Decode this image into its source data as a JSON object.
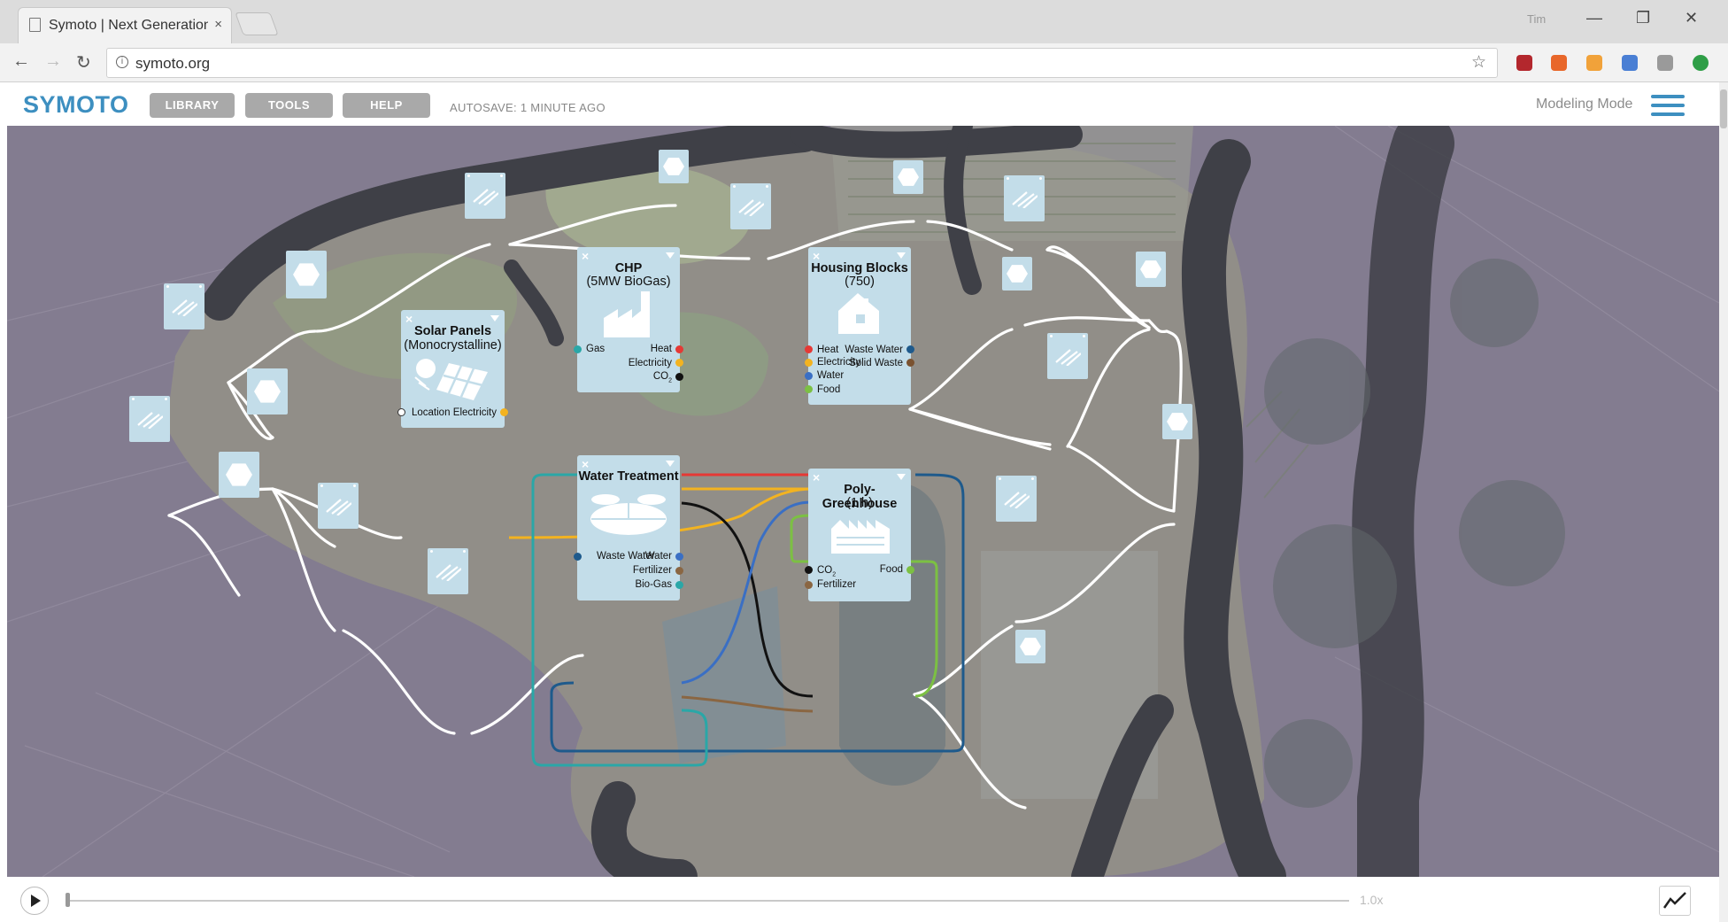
{
  "browser": {
    "tab_title": "Symoto | Next Generation",
    "user_label": "Tim",
    "url": "symoto.org"
  },
  "app": {
    "logo": "SYMOTO",
    "buttons": [
      "LIBRARY",
      "TOOLS",
      "HELP"
    ],
    "autosave": "AUTOSAVE: 1 MINUTE AGO",
    "mode": "Modeling Mode",
    "accent_color": "#3d8fc0"
  },
  "modules": {
    "solar": {
      "title": "Solar Panels",
      "subtitle": "(Monocrystalline)",
      "inputs": [
        "Location"
      ],
      "outputs": [
        "Electricity"
      ]
    },
    "chp": {
      "title": "CHP",
      "subtitle": "(5MW BioGas)",
      "inputs": [
        "Gas"
      ],
      "outputs": [
        "Heat",
        "Electricity",
        "CO",
        "2"
      ]
    },
    "housing": {
      "title": "Housing Blocks",
      "subtitle": "(750)",
      "inputs": [
        "Heat",
        "Electricity",
        "Water",
        "Food"
      ],
      "outputs": [
        "Waste Water",
        "Solid Waste"
      ]
    },
    "water": {
      "title": "Water Treatment",
      "inputs": [
        "Waste Water"
      ],
      "outputs": [
        "Water",
        "Fertilizer",
        "Bio-Gas"
      ]
    },
    "greenhouse": {
      "title": "Poly-Greenhouse",
      "subtitle": "(1 h)",
      "inputs": [
        "CO",
        "2",
        "Fertilizer"
      ],
      "outputs": [
        "Food"
      ]
    }
  },
  "flow_colors": {
    "heat": "#e53935",
    "electricity": "#f3b320",
    "co2": "#111111",
    "water": "#3a6fc4",
    "food": "#7cc043",
    "waste_water": "#1e5a8c",
    "solid_waste": "#7a5230",
    "fertilizer": "#8a6642",
    "biogas": "#2aa7a7"
  },
  "playback": {
    "speed": "1.0x"
  },
  "icons": [
    "play-icon",
    "graph-icon",
    "hamburger-menu-icon",
    "factory-icon",
    "house-icon",
    "greenhouse-icon",
    "water-treatment-icon",
    "solar-panel-icon"
  ]
}
